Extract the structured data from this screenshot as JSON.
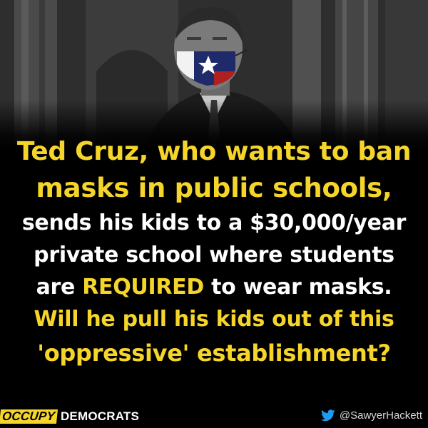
{
  "headline": {
    "line1": "Ted Cruz, who wants to ban",
    "line2": "masks in public schools,"
  },
  "body": {
    "line1": "sends his kids to a $30,000/year",
    "line2": "private school where students",
    "line3_before": "are ",
    "line3_highlight": "REQUIRED",
    "line3_after": " to wear masks."
  },
  "question": {
    "line1": "Will he pull his kids out of this",
    "line2": "'oppressive' establishment?"
  },
  "footer": {
    "brand_part1": "OCCUPY",
    "brand_part2": "DEMOCRATS",
    "handle": "@SawyerHackett"
  },
  "colors": {
    "accent_yellow": "#f5d52a",
    "background": "#000000",
    "text_white": "#ffffff",
    "twitter_blue": "#1d9bf0"
  },
  "icons": {
    "social": "twitter-bird-icon"
  }
}
